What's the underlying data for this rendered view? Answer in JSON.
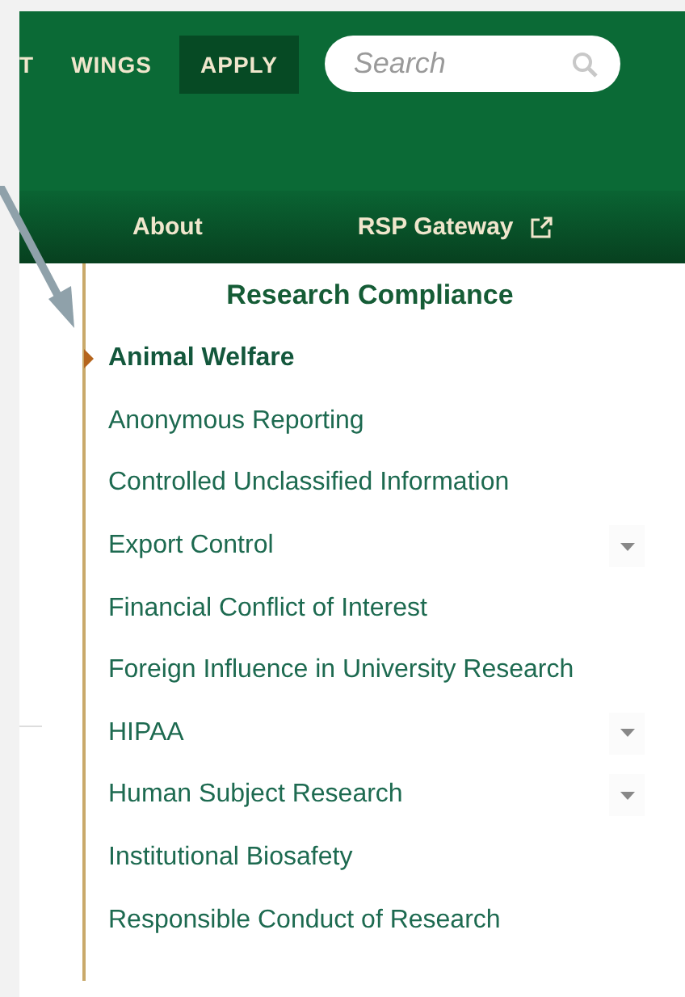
{
  "top_nav": [
    {
      "label": "T",
      "selected": false
    },
    {
      "label": "WINGS",
      "selected": false
    },
    {
      "label": "APPLY",
      "selected": true
    }
  ],
  "search": {
    "placeholder": "Search"
  },
  "sub_nav": [
    {
      "label": "About",
      "external": false
    },
    {
      "label": "RSP Gateway",
      "external": true
    }
  ],
  "sidebar": {
    "title": "Research Compliance",
    "items": [
      {
        "label": "Animal Welfare",
        "selected": true,
        "expandable": false
      },
      {
        "label": "Anonymous Reporting",
        "selected": false,
        "expandable": false
      },
      {
        "label": "Controlled Unclassified Information",
        "selected": false,
        "expandable": false
      },
      {
        "label": "Export Control",
        "selected": false,
        "expandable": true
      },
      {
        "label": "Financial Conflict of Interest",
        "selected": false,
        "expandable": false
      },
      {
        "label": "Foreign Influence in University Research",
        "selected": false,
        "expandable": false
      },
      {
        "label": "HIPAA",
        "selected": false,
        "expandable": true
      },
      {
        "label": "Human Subject Research",
        "selected": false,
        "expandable": true
      },
      {
        "label": "Institutional Biosafety",
        "selected": false,
        "expandable": false
      },
      {
        "label": "Responsible Conduct of Research",
        "selected": false,
        "expandable": false
      }
    ]
  }
}
